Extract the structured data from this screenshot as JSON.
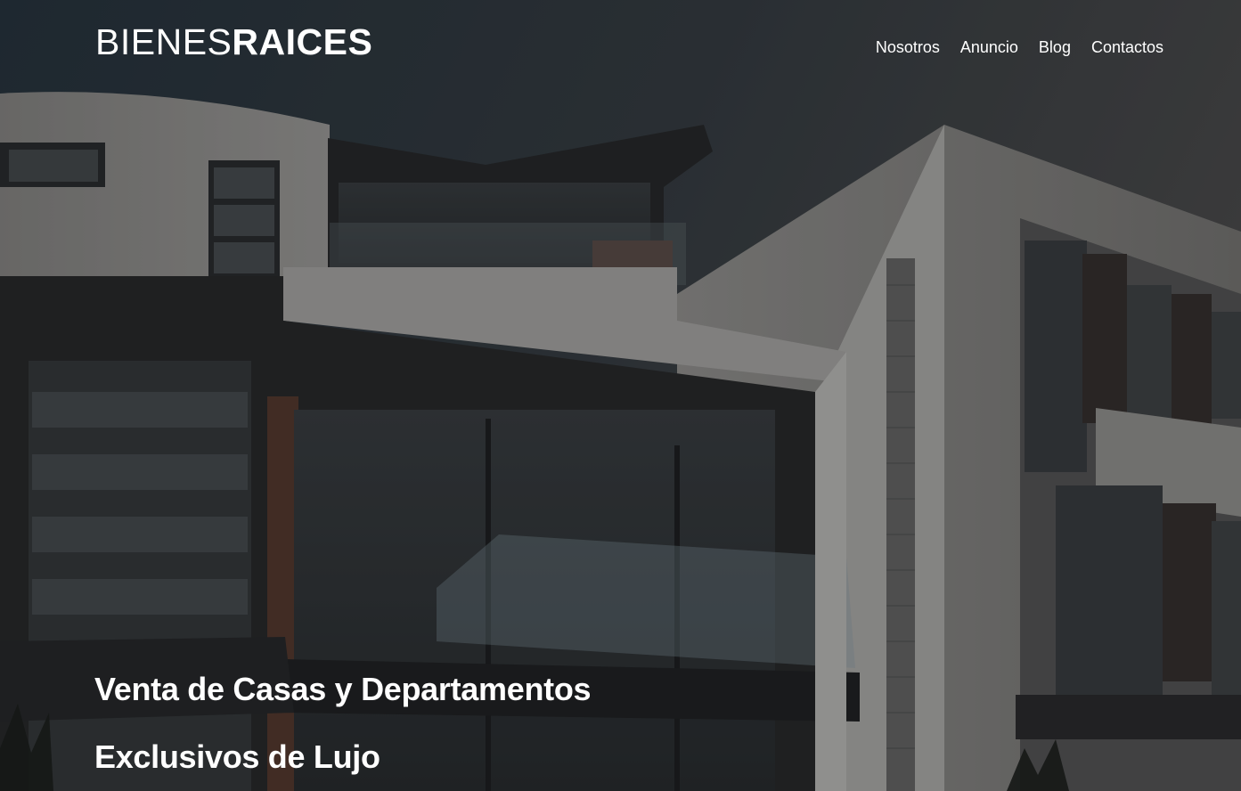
{
  "header": {
    "logo": {
      "light": "BIENES",
      "bold": "RAICES"
    },
    "nav": [
      {
        "label": "Nosotros"
      },
      {
        "label": "Anuncio"
      },
      {
        "label": "Blog"
      },
      {
        "label": "Contactos"
      }
    ]
  },
  "hero": {
    "headline": "Venta de Casas y Departamentos Exclusivos de Lujo",
    "image": "modern-house-facade-photo"
  },
  "colors": {
    "text": "#ffffff",
    "overlay": "rgba(0,0,0,0.28)",
    "sky_top": "#2f3a44",
    "sky_right": "#4a4b4d"
  }
}
